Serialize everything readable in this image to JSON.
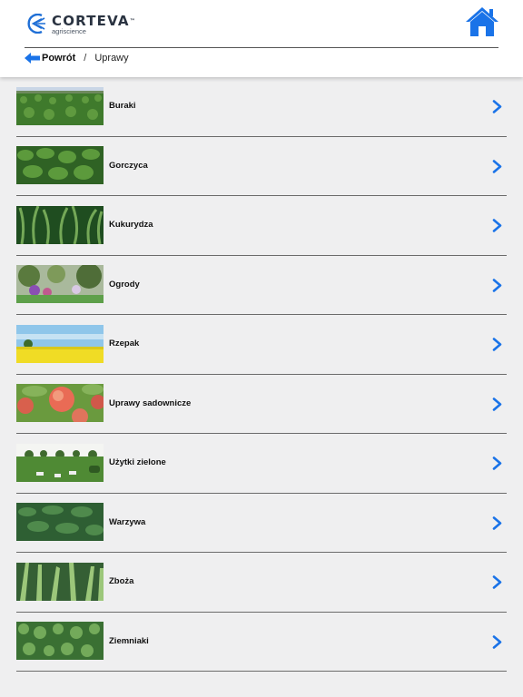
{
  "header": {
    "logo": {
      "name": "CORTEVA",
      "tm": "™",
      "subtitle": "agriscience"
    },
    "home_icon": "home-icon",
    "accent_color": "#1a73e8"
  },
  "breadcrumb": {
    "back_label": "Powrót",
    "separator": "/",
    "current": "Uprawy"
  },
  "crops": [
    {
      "label": "Buraki",
      "image": "sugar-beet-field"
    },
    {
      "label": "Gorczyca",
      "image": "mustard-leaves"
    },
    {
      "label": "Kukurydza",
      "image": "maize-plants"
    },
    {
      "label": "Ogrody",
      "image": "garden"
    },
    {
      "label": "Rzepak",
      "image": "rapeseed-field"
    },
    {
      "label": "Uprawy sadownicze",
      "image": "apples"
    },
    {
      "label": "Użytki zielone",
      "image": "grassland-cows"
    },
    {
      "label": "Warzywa",
      "image": "vegetable-leaves"
    },
    {
      "label": "Zboża",
      "image": "cereal-ears"
    },
    {
      "label": "Ziemniaki",
      "image": "potato-plants"
    }
  ]
}
